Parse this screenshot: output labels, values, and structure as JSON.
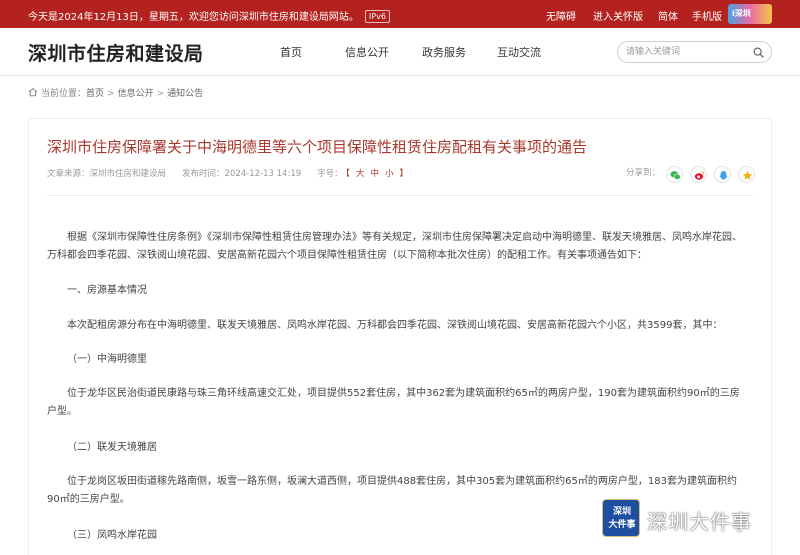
{
  "topbar": {
    "welcome": "今天是2024年12月13日，星期五，欢迎您访问深圳市住房和建设局网站。",
    "ipv6": "IPv6",
    "links": [
      "无障碍",
      "进入关怀版",
      "简体",
      "手机版"
    ],
    "logo_text": "i深圳"
  },
  "header": {
    "site_title": "深圳市住房和建设局",
    "nav": [
      "首页",
      "信息公开",
      "政务服务",
      "互动交流"
    ],
    "search_placeholder": "请输入关键词"
  },
  "breadcrumb": {
    "label": "当前位置：",
    "items": [
      "首页",
      "信息公开",
      "通知公告"
    ]
  },
  "article": {
    "title": "深圳市住房保障署关于中海明德里等六个项目保障性租赁住房配租有关事项的通告",
    "source_label": "文章来源：",
    "source": "深圳市住房和建设局",
    "date_label": "发布时间：",
    "date": "2024-12-13 14:19",
    "font_label": "字号：",
    "font_bracket_open": "【",
    "font_sizes": [
      "大",
      "中",
      "小"
    ],
    "font_bracket_close": "】",
    "share_label": "分享到：",
    "paragraphs": [
      "根据《深圳市保障性住房条例》《深圳市保障性租赁住房管理办法》等有关规定，深圳市住房保障署决定启动中海明德里、联发天境雅居、凤鸣水岸花园、万科都会四季花园、深铁阅山境花园、安居高新花园六个项目保障性租赁住房（以下简称本批次住房）的配租工作。有关事项通告如下：",
      "一、房源基本情况",
      "本次配租房源分布在中海明德里、联发天境雅居、凤鸣水岸花园、万科都会四季花园、深铁阅山境花园、安居高新花园六个小区，共3599套，其中：",
      "（一）中海明德里",
      "位于龙华区民治街道民康路与珠三角环线高速交汇处，项目提供552套住房，其中362套为建筑面积约65㎡的两房户型，190套为建筑面积约90㎡的三房户型。",
      "（二）联发天境雅居",
      "位于龙岗区坂田街道稼先路南侧，坂雪一路东侧，坂澜大道西侧，项目提供488套住房，其中305套为建筑面积约65㎡的两房户型，183套为建筑面积约90㎡的三房户型。",
      "（三）凤鸣水岸花园"
    ]
  },
  "watermark": {
    "badge_line1": "深圳",
    "badge_line2": "大件事",
    "text": "深圳大件事"
  },
  "colors": {
    "topbar": "#b3221e",
    "title": "#a8382d",
    "body_text": "#444444",
    "wechat": "#3fb34f",
    "weibo": "#e6162d",
    "qq": "#3fa0e8",
    "star": "#f2b01e"
  }
}
